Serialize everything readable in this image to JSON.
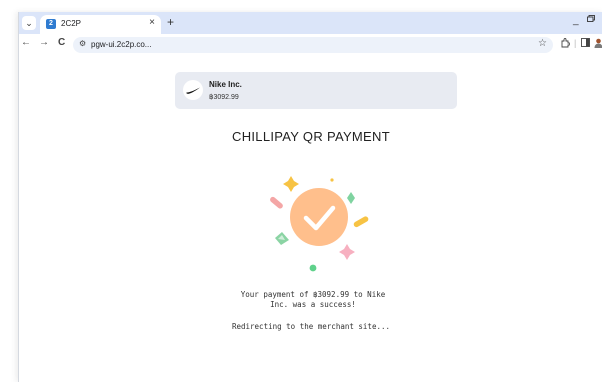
{
  "browser": {
    "tab_title": "2C2P",
    "favicon_text": "2",
    "tab_close": "×",
    "new_tab": "+",
    "url": "pgw-ui.2c2p.co...",
    "nav_back": "←",
    "nav_forward": "→",
    "nav_reload": "C",
    "site_info": "⚙",
    "bookmark": "☆",
    "minimize": "_"
  },
  "merchant": {
    "name": "Nike Inc.",
    "amount": "฿3092.99"
  },
  "page": {
    "title": "CHILLIPAY QR PAYMENT",
    "message": "Your payment of ฿3092.99 to Nike Inc. was a success!",
    "redirect": "Redirecting to the merchant site..."
  },
  "colors": {
    "accent": "#ffbf8c",
    "tabstrip": "#dbe5f9"
  }
}
